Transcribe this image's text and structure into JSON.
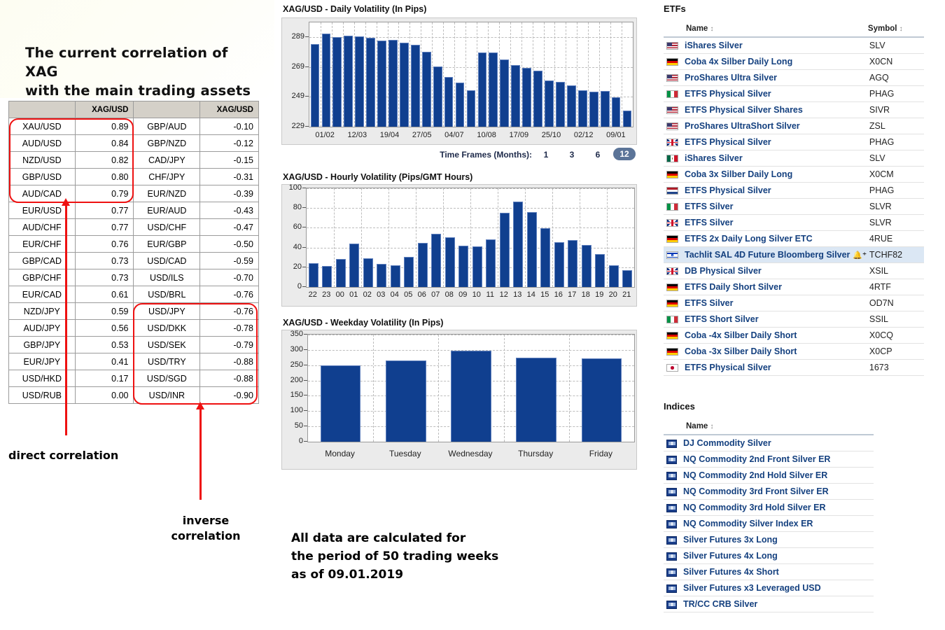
{
  "left": {
    "heading": "The current correlation of XAG\nwith the main trading assets",
    "table": {
      "headers": [
        "",
        "XAG/USD",
        "",
        "XAG/USD"
      ],
      "rows": [
        [
          "XAU/USD",
          "0.89",
          "GBP/AUD",
          "-0.10"
        ],
        [
          "AUD/USD",
          "0.84",
          "GBP/NZD",
          "-0.12"
        ],
        [
          "NZD/USD",
          "0.82",
          "CAD/JPY",
          "-0.15"
        ],
        [
          "GBP/USD",
          "0.80",
          "CHF/JPY",
          "-0.31"
        ],
        [
          "AUD/CAD",
          "0.79",
          "EUR/NZD",
          "-0.39"
        ],
        [
          "EUR/USD",
          "0.77",
          "EUR/AUD",
          "-0.43"
        ],
        [
          "AUD/CHF",
          "0.77",
          "USD/CHF",
          "-0.47"
        ],
        [
          "EUR/CHF",
          "0.76",
          "EUR/GBP",
          "-0.50"
        ],
        [
          "GBP/CAD",
          "0.73",
          "USD/CAD",
          "-0.59"
        ],
        [
          "GBP/CHF",
          "0.73",
          "USD/ILS",
          "-0.70"
        ],
        [
          "EUR/CAD",
          "0.61",
          "USD/BRL",
          "-0.76"
        ],
        [
          "NZD/JPY",
          "0.59",
          "USD/JPY",
          "-0.76"
        ],
        [
          "AUD/JPY",
          "0.56",
          "USD/DKK",
          "-0.78"
        ],
        [
          "GBP/JPY",
          "0.53",
          "USD/SEK",
          "-0.79"
        ],
        [
          "EUR/JPY",
          "0.41",
          "USD/TRY",
          "-0.88"
        ],
        [
          "USD/HKD",
          "0.17",
          "USD/SGD",
          "-0.88"
        ],
        [
          "USD/RUB",
          "0.00",
          "USD/INR",
          "-0.90"
        ]
      ]
    },
    "annotations": {
      "direct": "direct correlation",
      "inverse": "inverse\ncorrelation"
    },
    "footnote": "All data are calculated for\nthe period of 50 trading weeks\n as of 09.01.2019",
    "accent_red": "#ee1111"
  },
  "timeframes": {
    "label": "Time Frames (Months):",
    "options": [
      "1",
      "3",
      "6",
      "12"
    ],
    "selected": "12",
    "active_color": "#5b7498"
  },
  "chart_data": [
    {
      "type": "bar",
      "title": "XAG/USD - Daily Volatility (In Pips)",
      "xlabel": "",
      "ylabel": "",
      "ylim": [
        229,
        299
      ],
      "yticks": [
        229,
        249,
        269,
        289
      ],
      "grid": true,
      "bar_color": "#103f8f",
      "categories": [
        "01/02",
        "",
        "",
        "12/03",
        "",
        "",
        "19/04",
        "",
        "",
        "27/05",
        "",
        "",
        "04/07",
        "",
        "",
        "10/08",
        "",
        "",
        "17/09",
        "",
        "",
        "25/10",
        "",
        "",
        "02/12",
        "",
        "",
        "09/01",
        "",
        ""
      ],
      "tick_labels": [
        "01/02",
        "12/03",
        "19/04",
        "27/05",
        "04/07",
        "10/08",
        "17/09",
        "25/10",
        "02/12",
        "09/01"
      ],
      "values": [
        284.5,
        291.5,
        289.2,
        290.0,
        289.7,
        288.8,
        287.0,
        287.4,
        285.2,
        284.2,
        279.5,
        269.5,
        262.5,
        258.5,
        253.5,
        279.0,
        279.0,
        274.0,
        270.5,
        268.5,
        266.8,
        260.0,
        259.0,
        256.5,
        253.5,
        252.5,
        253.0,
        248.7,
        240.0
      ]
    },
    {
      "type": "bar",
      "title": "XAG/USD - Hourly Volatility (Pips/GMT Hours)",
      "xlabel": "",
      "ylabel": "",
      "ylim": [
        0,
        100
      ],
      "yticks": [
        0,
        20,
        40,
        60,
        80,
        100
      ],
      "grid": true,
      "bar_color": "#103f8f",
      "categories": [
        "22",
        "23",
        "00",
        "01",
        "02",
        "03",
        "04",
        "05",
        "06",
        "07",
        "08",
        "09",
        "10",
        "11",
        "12",
        "13",
        "14",
        "15",
        "16",
        "17",
        "18",
        "19",
        "20",
        "21"
      ],
      "values": [
        24.2,
        21.0,
        28.6,
        43.7,
        29.3,
        23.6,
        22.3,
        30.5,
        44.4,
        53.6,
        50.3,
        41.8,
        41.2,
        48.4,
        74.9,
        86.8,
        76.2,
        59.8,
        45.6,
        47.4,
        42.4,
        33.1,
        22.2,
        17.2
      ]
    },
    {
      "type": "bar",
      "title": "XAG/USD - Weekday Volatility (In Pips)",
      "xlabel": "",
      "ylabel": "",
      "ylim": [
        0,
        350
      ],
      "yticks": [
        0,
        50,
        100,
        150,
        200,
        250,
        300,
        350
      ],
      "grid": true,
      "bar_color": "#103f8f",
      "categories": [
        "Monday",
        "Tuesday",
        "Wednesday",
        "Thursday",
        "Friday"
      ],
      "values": [
        249,
        266,
        297,
        275,
        273
      ]
    }
  ],
  "etfs": {
    "title": "ETFs",
    "columns": [
      "Name",
      "Symbol"
    ],
    "rows": [
      {
        "flag": "us",
        "name": "iShares Silver",
        "symbol": "SLV"
      },
      {
        "flag": "de",
        "name": "Coba 4x Silber Daily Long",
        "symbol": "X0CN"
      },
      {
        "flag": "us",
        "name": "ProShares Ultra Silver",
        "symbol": "AGQ"
      },
      {
        "flag": "it",
        "name": "ETFS Physical Silver",
        "symbol": "PHAG"
      },
      {
        "flag": "us",
        "name": "ETFS Physical Silver Shares",
        "symbol": "SIVR"
      },
      {
        "flag": "us",
        "name": "ProShares UltraShort Silver",
        "symbol": "ZSL"
      },
      {
        "flag": "gb",
        "name": "ETFS Physical Silver",
        "symbol": "PHAG"
      },
      {
        "flag": "mx",
        "name": "iShares Silver",
        "symbol": "SLV"
      },
      {
        "flag": "de",
        "name": "Coba 3x Silber Daily Long",
        "symbol": "X0CM"
      },
      {
        "flag": "nl",
        "name": "ETFS Physical Silver",
        "symbol": "PHAG"
      },
      {
        "flag": "it",
        "name": "ETFS Silver",
        "symbol": "SLVR"
      },
      {
        "flag": "gb",
        "name": "ETFS Silver",
        "symbol": "SLVR"
      },
      {
        "flag": "de",
        "name": "ETFS 2x Daily Long Silver ETC",
        "symbol": "4RUE"
      },
      {
        "flag": "il",
        "name": "Tachlit SAL 4D Future Bloomberg Silver",
        "symbol": "TCHF82",
        "bell": true,
        "highlight": true
      },
      {
        "flag": "gb",
        "name": "DB Physical Silver",
        "symbol": "XSIL"
      },
      {
        "flag": "de",
        "name": "ETFS Daily Short Silver",
        "symbol": "4RTF"
      },
      {
        "flag": "de",
        "name": "ETFS Silver",
        "symbol": "OD7N"
      },
      {
        "flag": "it",
        "name": "ETFS Short Silver",
        "symbol": "SSIL"
      },
      {
        "flag": "de",
        "name": "Coba -4x Silber Daily Short",
        "symbol": "X0CQ"
      },
      {
        "flag": "de",
        "name": "Coba -3x Silber Daily Short",
        "symbol": "X0CP"
      },
      {
        "flag": "jp",
        "name": "ETFS Physical Silver",
        "symbol": "1673"
      }
    ]
  },
  "indices": {
    "title": "Indices",
    "columns": [
      "Name"
    ],
    "rows": [
      {
        "name": "DJ Commodity Silver"
      },
      {
        "name": "NQ Commodity 2nd Front Silver ER"
      },
      {
        "name": "NQ Commodity 2nd Hold Silver ER"
      },
      {
        "name": "NQ Commodity 3rd Front Silver ER"
      },
      {
        "name": "NQ Commodity 3rd Hold Silver ER"
      },
      {
        "name": "NQ Commodity Silver Index ER"
      },
      {
        "name": "Silver Futures 3x Long"
      },
      {
        "name": "Silver Futures 4x Long"
      },
      {
        "name": "Silver Futures 4x Short"
      },
      {
        "name": "Silver Futures x3 Leveraged USD"
      },
      {
        "name": "TR/CC CRB Silver"
      }
    ]
  }
}
